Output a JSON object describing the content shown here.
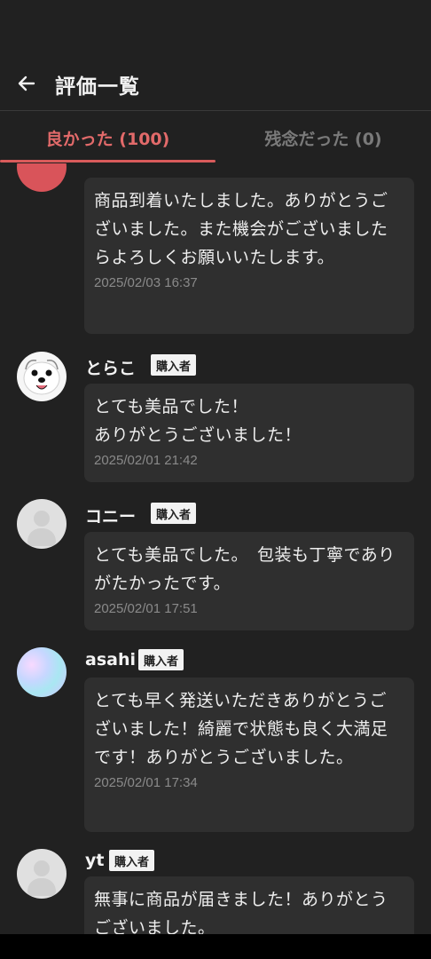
{
  "header": {
    "title": "評価一覧"
  },
  "tabs": {
    "good_label": "良かった (100)",
    "bad_label": "残念だった (0)"
  },
  "reviews": [
    {
      "name": "",
      "badge": "",
      "text": "商品到着いたしました。ありがとうございました。また機会がございましたらよろしくお願いいたします。",
      "date": "2025/02/03 16:37"
    },
    {
      "name": "とらこ",
      "badge": "購入者",
      "text": "とても美品でした！\nありがとうございました！",
      "date": "2025/02/01 21:42"
    },
    {
      "name": "コニー",
      "badge": "購入者",
      "text": "とても美品でした。　包装も丁寧でありがたかったです。",
      "date": "2025/02/01 17:51"
    },
    {
      "name": "asahi",
      "badge": "購入者",
      "text": "とても早く発送いただきありがとうございました！綺麗で状態も良く大満足です！ありがとうございました。",
      "date": "2025/02/01 17:34"
    },
    {
      "name": "yt",
      "badge": "購入者",
      "text": "無事に商品が届きました！ありがとうございました。",
      "date": ""
    }
  ]
}
